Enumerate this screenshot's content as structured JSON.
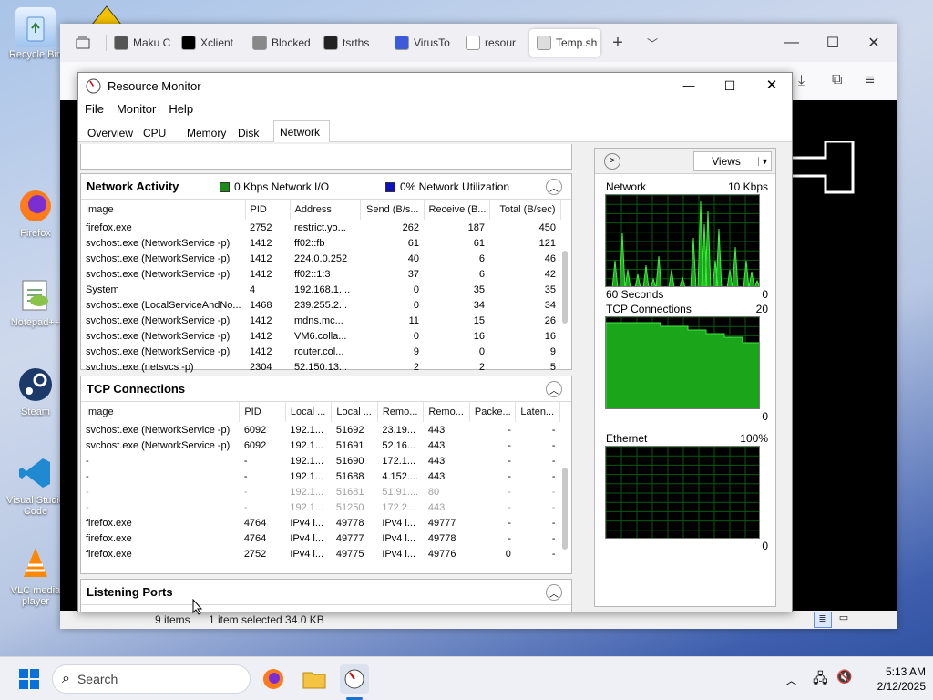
{
  "desktop": {
    "icons": [
      {
        "label": "Recycle Bin"
      },
      {
        "label": "Firefox"
      },
      {
        "label": "Notepad++"
      },
      {
        "label": "Steam"
      },
      {
        "label": "Visual Studio Code"
      },
      {
        "label": "VLC media player"
      }
    ]
  },
  "browser": {
    "tabs": [
      {
        "label": "Maku C",
        "color": "#555"
      },
      {
        "label": "Xclient",
        "color": "#000"
      },
      {
        "label": "Blocked",
        "color": "#888"
      },
      {
        "label": "tsrths",
        "color": "#222"
      },
      {
        "label": "VirusTo",
        "color": "#3b5bdb"
      },
      {
        "label": "resour",
        "color": "#fff"
      },
      {
        "label": "Temp.sh",
        "color": "#ddd"
      }
    ],
    "status": {
      "items": "9 items",
      "selected": "1 item selected  34.0 KB"
    }
  },
  "resmon": {
    "title": "Resource Monitor",
    "menu": [
      "File",
      "Monitor",
      "Help"
    ],
    "tabs": [
      "Overview",
      "CPU",
      "Memory",
      "Disk",
      "Network"
    ],
    "network_activity": {
      "header": "Network Activity",
      "legend_io": "0 Kbps Network I/O",
      "legend_util": "0% Network Utilization",
      "io_color": "#1a8a1a",
      "util_color": "#1010c0",
      "columns": [
        "Image",
        "PID",
        "Address",
        "Send (B/s...",
        "Receive (B...",
        "Total (B/sec)"
      ],
      "rows": [
        [
          "firefox.exe",
          "2752",
          "restrict.yo...",
          "262",
          "187",
          "450"
        ],
        [
          "svchost.exe (NetworkService -p)",
          "1412",
          "ff02::fb",
          "61",
          "61",
          "121"
        ],
        [
          "svchost.exe (NetworkService -p)",
          "1412",
          "224.0.0.252",
          "40",
          "6",
          "46"
        ],
        [
          "svchost.exe (NetworkService -p)",
          "1412",
          "ff02::1:3",
          "37",
          "6",
          "42"
        ],
        [
          "System",
          "4",
          "192.168.1....",
          "0",
          "35",
          "35"
        ],
        [
          "svchost.exe (LocalServiceAndNo...",
          "1468",
          "239.255.2...",
          "0",
          "34",
          "34"
        ],
        [
          "svchost.exe (NetworkService -p)",
          "1412",
          "mdns.mc...",
          "11",
          "15",
          "26"
        ],
        [
          "svchost.exe (NetworkService -p)",
          "1412",
          "VM6.colla...",
          "0",
          "16",
          "16"
        ],
        [
          "svchost.exe (NetworkService -p)",
          "1412",
          "router.col...",
          "9",
          "0",
          "9"
        ],
        [
          "svchost.exe (netsvcs -p)",
          "2304",
          "52.150.13...",
          "2",
          "2",
          "5"
        ]
      ]
    },
    "tcp": {
      "header": "TCP Connections",
      "columns": [
        "Image",
        "PID",
        "Local ...",
        "Local ...",
        "Remo...",
        "Remo...",
        "Packe...",
        "Laten..."
      ],
      "rows": [
        [
          "svchost.exe (NetworkService -p)",
          "6092",
          "192.1...",
          "51692",
          "23.19...",
          "443",
          "-",
          "-",
          false
        ],
        [
          "svchost.exe (NetworkService -p)",
          "6092",
          "192.1...",
          "51691",
          "52.16...",
          "443",
          "-",
          "-",
          false
        ],
        [
          "-",
          "-",
          "192.1...",
          "51690",
          "172.1...",
          "443",
          "-",
          "-",
          false
        ],
        [
          "-",
          "-",
          "192.1...",
          "51688",
          "4.152....",
          "443",
          "-",
          "-",
          false
        ],
        [
          "-",
          "-",
          "192.1...",
          "51681",
          "51.91....",
          "80",
          "-",
          "-",
          true
        ],
        [
          "-",
          "-",
          "192.1...",
          "51250",
          "172.2...",
          "443",
          "-",
          "-",
          true
        ],
        [
          "firefox.exe",
          "4764",
          "IPv4 l...",
          "49778",
          "IPv4 l...",
          "49777",
          "-",
          "-",
          false
        ],
        [
          "firefox.exe",
          "4764",
          "IPv4 l...",
          "49777",
          "IPv4 l...",
          "49778",
          "-",
          "-",
          false
        ],
        [
          "firefox.exe",
          "2752",
          "IPv4 l...",
          "49775",
          "IPv4 l...",
          "49776",
          "0",
          "-",
          false
        ]
      ]
    },
    "listening": {
      "header": "Listening Ports"
    },
    "graphs": {
      "views_label": "Views",
      "network": {
        "label": "Network",
        "max": "10 Kbps",
        "time": "60 Seconds",
        "min": "0"
      },
      "tcp": {
        "label": "TCP Connections",
        "max": "20",
        "min": "0"
      },
      "ethernet": {
        "label": "Ethernet",
        "max": "100%",
        "min": "0"
      }
    }
  },
  "taskbar": {
    "search_placeholder": "Search",
    "time": "5:13 AM",
    "date": "2/12/2025"
  }
}
